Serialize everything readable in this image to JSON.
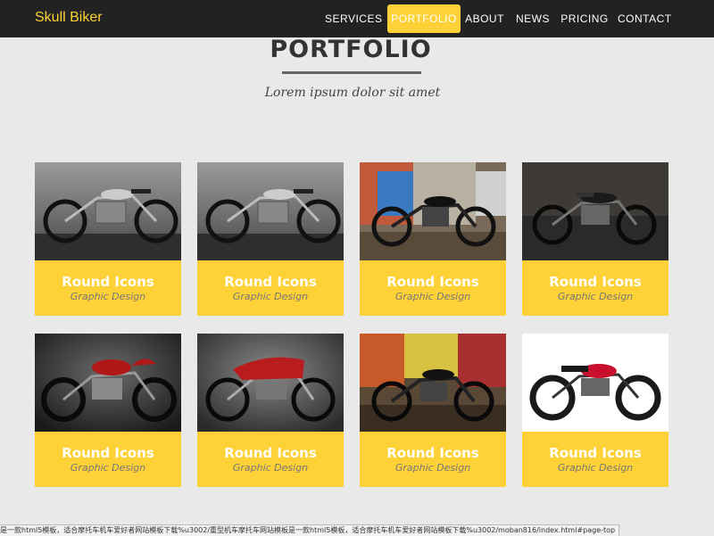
{
  "brand": "Skull Biker",
  "nav": {
    "items": [
      "SERVICES",
      "PORTFOLIO",
      "ABOUT",
      "NEWS",
      "PRICING",
      "CONTACT"
    ],
    "active": "PORTFOLIO"
  },
  "section": {
    "title": "PORTFOLIO",
    "subtitle": "Lorem ipsum dolor sit amet"
  },
  "portfolio": [
    {
      "title": "Round Icons",
      "subtitle": "Graphic Design",
      "image": "motorcycle-photo"
    },
    {
      "title": "Round Icons",
      "subtitle": "Graphic Design",
      "image": "motorcycle-photo"
    },
    {
      "title": "Round Icons",
      "subtitle": "Graphic Design",
      "image": "motorcycle-photo"
    },
    {
      "title": "Round Icons",
      "subtitle": "Graphic Design",
      "image": "motorcycle-photo"
    },
    {
      "title": "Round Icons",
      "subtitle": "Graphic Design",
      "image": "motorcycle-photo"
    },
    {
      "title": "Round Icons",
      "subtitle": "Graphic Design",
      "image": "motorcycle-photo"
    },
    {
      "title": "Round Icons",
      "subtitle": "Graphic Design",
      "image": "motorcycle-photo"
    },
    {
      "title": "Round Icons",
      "subtitle": "Graphic Design",
      "image": "motorcycle-photo"
    }
  ],
  "status_bar": {
    "url": "是一款html5模板，适合摩托车机车爱好者网站模板下载%u3002/重型机车摩托车网站模板是一款html5模板，适合摩托车机车爱好者网站模板下载%u3002/moban816/index.html#page-top"
  },
  "colors": {
    "accent": "#fed136",
    "navbar": "#222222",
    "background": "#e9e9e9"
  }
}
